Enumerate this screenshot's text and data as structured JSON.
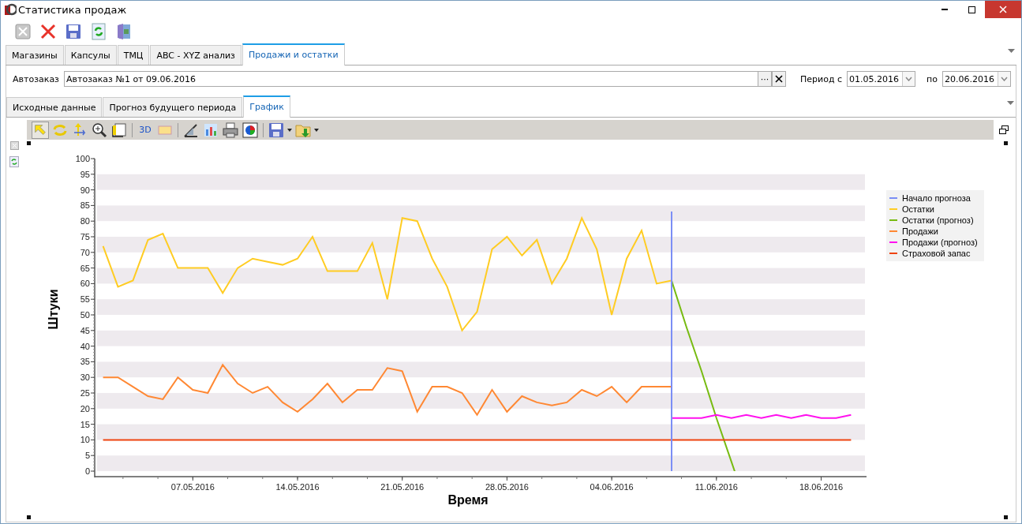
{
  "window": {
    "title": "Статистика продаж"
  },
  "tabs": [
    {
      "label": "Магазины",
      "selected": false
    },
    {
      "label": "Капсулы",
      "selected": false
    },
    {
      "label": "ТМЦ",
      "selected": false
    },
    {
      "label": "ABC - XYZ анализ",
      "selected": false
    },
    {
      "label": "Продажи и остатки",
      "selected": true
    }
  ],
  "filter": {
    "autozakaz_label": "Автозаказ",
    "autozakaz_value": "Автозаказ №1 от 09.06.2016",
    "browse_button": "···",
    "period_from_label": "Период с",
    "period_from": "01.05.2016",
    "period_to_label": "по",
    "period_to": "20.06.2016"
  },
  "subtabs": [
    {
      "label": "Исходные данные",
      "selected": false
    },
    {
      "label": "Прогноз будущего периода",
      "selected": false
    },
    {
      "label": "График",
      "selected": true
    }
  ],
  "chart_toolbar": {
    "label_3d": "3D"
  },
  "chart": {
    "chart_data": {
      "type": "line",
      "xlabel": "Время",
      "ylabel": "Штуки",
      "ylim": [
        0,
        100
      ],
      "yticks": [
        0,
        5,
        10,
        15,
        20,
        25,
        30,
        35,
        40,
        45,
        50,
        55,
        60,
        65,
        70,
        75,
        80,
        85,
        90,
        95,
        100
      ],
      "categories": [
        null,
        null,
        null,
        null,
        null,
        null,
        "07.05.2016",
        null,
        null,
        null,
        null,
        null,
        null,
        "14.05.2016",
        null,
        null,
        null,
        null,
        null,
        null,
        "21.05.2016",
        null,
        null,
        null,
        null,
        null,
        null,
        "28.05.2016",
        null,
        null,
        null,
        null,
        null,
        null,
        "04.06.2016",
        null,
        null,
        null,
        null,
        null,
        null,
        "11.06.2016",
        null,
        null,
        null,
        null,
        null,
        null,
        "18.06.2016",
        null,
        null
      ],
      "legend": true,
      "series": [
        {
          "name": "Остатки",
          "color": "#ffcc22",
          "values": [
            72,
            59,
            61,
            74,
            76,
            65,
            65,
            65,
            57,
            65,
            68,
            67,
            66,
            68,
            75,
            64,
            64,
            64,
            73,
            55,
            81,
            80,
            68,
            59,
            45,
            51,
            71,
            75,
            69,
            74,
            60,
            68,
            81,
            71,
            50,
            68,
            77,
            60,
            61,
            null,
            null,
            null,
            null,
            null,
            null,
            null,
            null,
            null,
            null,
            null,
            null
          ]
        },
        {
          "name": "Остатки (прогноз)",
          "color": "#77bb11",
          "values": [
            null,
            null,
            null,
            null,
            null,
            null,
            null,
            null,
            null,
            null,
            null,
            null,
            null,
            null,
            null,
            null,
            null,
            null,
            null,
            null,
            null,
            null,
            null,
            null,
            null,
            null,
            null,
            null,
            null,
            null,
            null,
            null,
            null,
            null,
            null,
            null,
            null,
            null,
            61,
            46,
            32,
            17,
            3,
            null,
            null,
            null,
            null,
            null,
            null,
            null,
            null
          ]
        },
        {
          "name": "Продажи",
          "color": "#ff8833",
          "values": [
            30,
            30,
            27,
            24,
            23,
            30,
            26,
            25,
            34,
            28,
            25,
            27,
            22,
            19,
            23,
            28,
            22,
            26,
            26,
            33,
            32,
            19,
            27,
            27,
            25,
            18,
            26,
            19,
            24,
            22,
            21,
            22,
            26,
            24,
            27,
            22,
            27,
            27,
            27,
            null,
            null,
            null,
            null,
            null,
            null,
            null,
            null,
            null,
            null,
            null,
            null
          ]
        },
        {
          "name": "Продажи (прогноз)",
          "color": "#ff11ee",
          "values": [
            null,
            null,
            null,
            null,
            null,
            null,
            null,
            null,
            null,
            null,
            null,
            null,
            null,
            null,
            null,
            null,
            null,
            null,
            null,
            null,
            null,
            null,
            null,
            null,
            null,
            null,
            null,
            null,
            null,
            null,
            null,
            null,
            null,
            null,
            null,
            null,
            null,
            null,
            17,
            17,
            17,
            18,
            17,
            18,
            17,
            18,
            17,
            18,
            17,
            17,
            18
          ]
        },
        {
          "name": "Страховой запас",
          "color": "#ee4411",
          "values": [
            10,
            10,
            10,
            10,
            10,
            10,
            10,
            10,
            10,
            10,
            10,
            10,
            10,
            10,
            10,
            10,
            10,
            10,
            10,
            10,
            10,
            10,
            10,
            10,
            10,
            10,
            10,
            10,
            10,
            10,
            10,
            10,
            10,
            10,
            10,
            10,
            10,
            10,
            10,
            10,
            10,
            10,
            10,
            10,
            10,
            10,
            10,
            10,
            10,
            10,
            10
          ]
        }
      ]
    },
    "forecast_start": {
      "label": "Начало прогноза",
      "color": "#7b8ef5"
    }
  }
}
